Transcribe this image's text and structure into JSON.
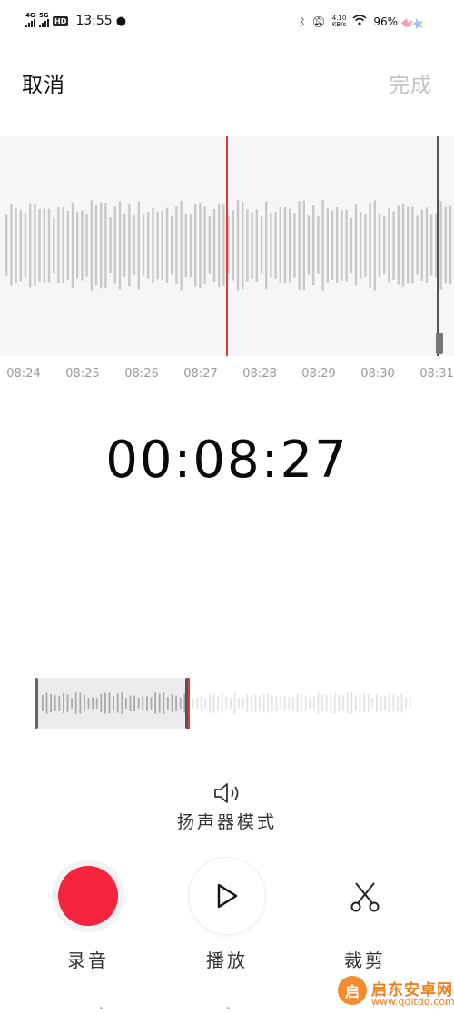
{
  "status_bar": {
    "net1": "4G",
    "net2": "5G",
    "hd": "HD",
    "time": "13:55",
    "net_speed_value": "4.10",
    "net_speed_unit": "KB/s",
    "battery": "96%"
  },
  "header": {
    "cancel_label": "取消",
    "done_label": "完成"
  },
  "waveform": {
    "ticks": [
      "08:24",
      "08:25",
      "08:26",
      "08:27",
      "08:28",
      "08:29",
      "08:30",
      "08:31"
    ],
    "bar_color": "#c8c8c8",
    "playhead_color": "#e53935"
  },
  "timer": "00:08:27",
  "speaker_mode_label": "扬声器模式",
  "controls": {
    "record_label": "录音",
    "play_label": "播放",
    "trim_label": "裁剪",
    "record_color": "#f5233e"
  },
  "watermark": {
    "logo_char": "启",
    "title": "启东安卓网",
    "url": "www.qdltdq.com"
  }
}
